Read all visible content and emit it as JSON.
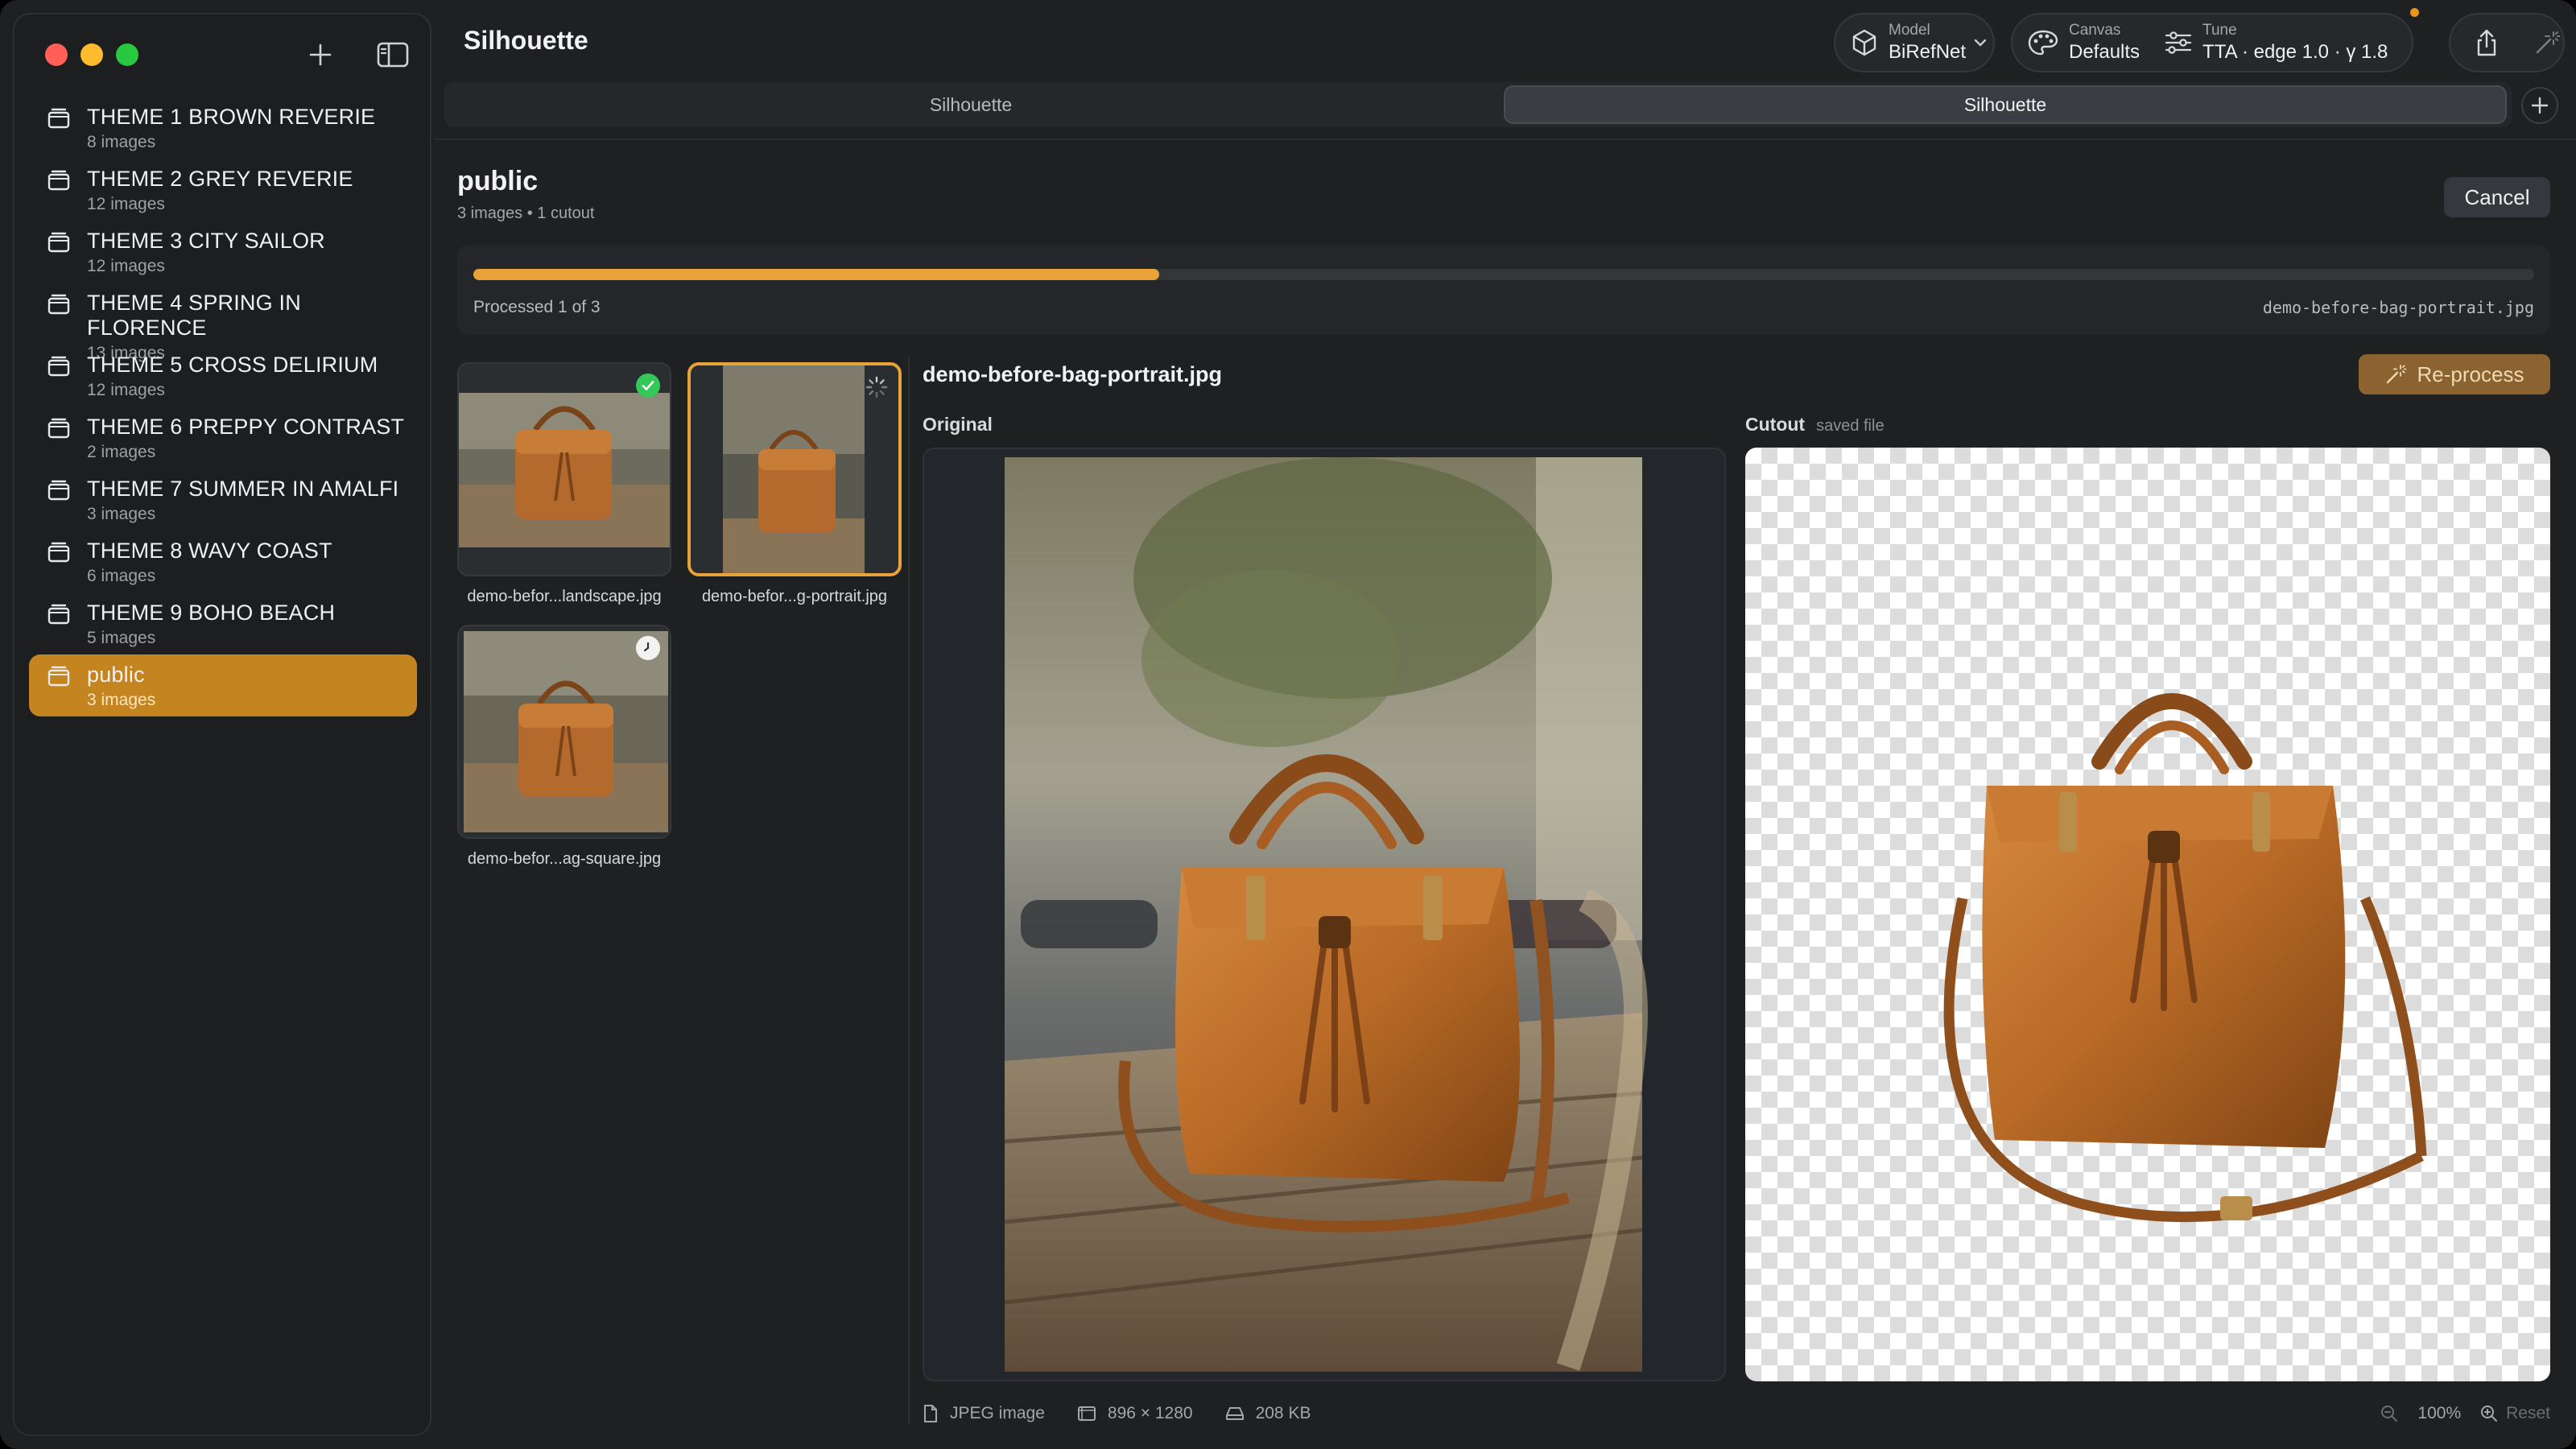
{
  "app": {
    "title": "Silhouette"
  },
  "sidebar": {
    "folders": [
      {
        "name": "THEME 1 BROWN REVERIE",
        "count": "8 images"
      },
      {
        "name": "THEME 2 GREY REVERIE",
        "count": "12 images"
      },
      {
        "name": "THEME 3 CITY SAILOR",
        "count": "12 images"
      },
      {
        "name": "THEME 4 SPRING IN FLORENCE",
        "count": "13 images"
      },
      {
        "name": "THEME 5 CROSS DELIRIUM",
        "count": "12 images"
      },
      {
        "name": "THEME 6 PREPPY CONTRAST",
        "count": "2 images"
      },
      {
        "name": "THEME 7 SUMMER IN AMALFI",
        "count": "3 images"
      },
      {
        "name": "THEME 8 WAVY COAST",
        "count": "6 images"
      },
      {
        "name": "THEME 9 BOHO BEACH",
        "count": "5 images"
      },
      {
        "name": "public",
        "count": "3 images"
      }
    ],
    "active_folder": "public"
  },
  "toolbar": {
    "model": {
      "caption": "Model",
      "value": "BiRefNet"
    },
    "canvas": {
      "caption": "Canvas",
      "value": "Defaults"
    },
    "tune": {
      "caption": "Tune",
      "value": "TTA · edge 1.0 · γ 1.8"
    }
  },
  "tabs": [
    {
      "label": "Silhouette",
      "active": false
    },
    {
      "label": "Silhouette",
      "active": true
    }
  ],
  "folder": {
    "title": "public",
    "subtitle": "3 images • 1 cutout",
    "cancel_label": "Cancel"
  },
  "progress": {
    "fraction": 0.333,
    "label": "Processed 1 of 3",
    "current_file": "demo-before-bag-portrait.jpg"
  },
  "thumbnails": [
    {
      "name": "demo-befor...landscape.jpg",
      "status": "done"
    },
    {
      "name": "demo-befor...g-portrait.jpg",
      "status": "processing"
    },
    {
      "name": "demo-befor...ag-square.jpg",
      "status": "queued"
    }
  ],
  "detail": {
    "filename": "demo-before-bag-portrait.jpg",
    "reprocess_label": "Re-process",
    "original_label": "Original",
    "cutout_label": "Cutout",
    "cutout_note": "saved file"
  },
  "footer": {
    "format": "JPEG image",
    "dimensions": "896 × 1280",
    "size": "208 KB",
    "zoom": "100%",
    "reset_label": "Reset"
  },
  "colors": {
    "accent": "#e8a23a",
    "sidebar_active": "#c4841f",
    "success": "#34c759"
  }
}
